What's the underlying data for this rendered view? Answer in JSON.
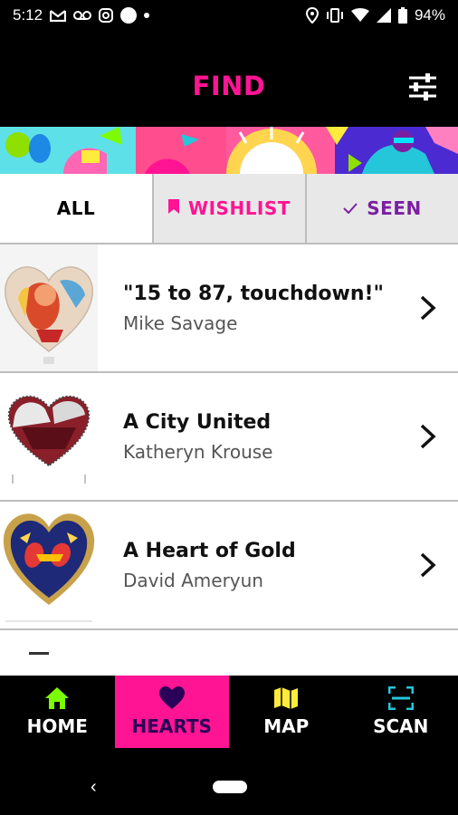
{
  "status_bar": {
    "time": "5:12",
    "battery": "94%",
    "icons": [
      "gmail-icon",
      "voicemail-icon",
      "instagram-icon",
      "circle-icon",
      "dot-icon",
      "location-icon",
      "vibrate-icon",
      "wifi-icon",
      "signal-icon",
      "battery-icon"
    ]
  },
  "header": {
    "title": "FIND",
    "filter_icon": "sliders-icon",
    "accent_color": "#ff1493"
  },
  "tabs": [
    {
      "label": "ALL",
      "icon": ""
    },
    {
      "label": "WISHLIST",
      "icon": "bookmark-icon"
    },
    {
      "label": "SEEN",
      "icon": "check-icon"
    }
  ],
  "items": [
    {
      "title": "\"15 to 87, touchdown!\"",
      "artist": "Mike Savage"
    },
    {
      "title": "A City United",
      "artist": "Katheryn Krouse"
    },
    {
      "title": "A Heart of Gold",
      "artist": "David Ameryun"
    }
  ],
  "bottom_nav": [
    {
      "label": "HOME",
      "icon": "home-icon"
    },
    {
      "label": "HEARTS",
      "icon": "heart-icon"
    },
    {
      "label": "MAP",
      "icon": "map-icon"
    },
    {
      "label": "SCAN",
      "icon": "scan-icon"
    }
  ],
  "colors": {
    "pink": "#ff1493",
    "purple": "#7b1fa2",
    "lime": "#7cfc00",
    "yellow": "#ffeb3b",
    "teal": "#26c6da"
  }
}
